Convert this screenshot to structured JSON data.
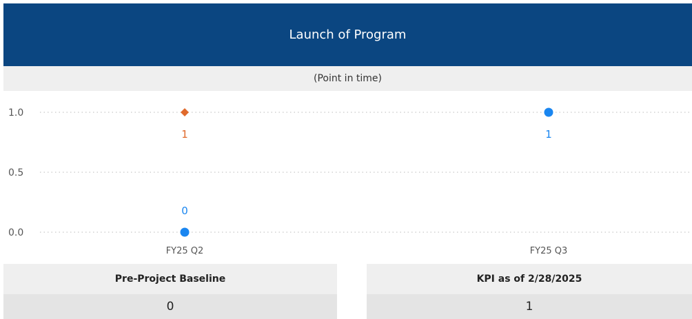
{
  "header": {
    "title": "Launch of Program",
    "subtitle": "(Point in time)"
  },
  "chart_data": {
    "type": "scatter",
    "categories": [
      "FY25 Q2",
      "FY25 Q3"
    ],
    "ylim": [
      0,
      1
    ],
    "yticks": [
      "1.0",
      "0.5",
      "0.0"
    ],
    "ytick_values": [
      1.0,
      0.5,
      0.0
    ],
    "grid": true,
    "series": [
      {
        "marker": "diamond",
        "color": "#e06a2c",
        "points": [
          {
            "category": "FY25 Q2",
            "value": 1,
            "label": "1"
          }
        ]
      },
      {
        "marker": "circle",
        "color": "#1a86f0",
        "points": [
          {
            "category": "FY25 Q2",
            "value": 0,
            "label": "0"
          },
          {
            "category": "FY25 Q3",
            "value": 1,
            "label": "1"
          }
        ]
      }
    ]
  },
  "cards": [
    {
      "label": "Pre-Project Baseline",
      "value": "0"
    },
    {
      "label": "KPI as of 2/28/2025",
      "value": "1"
    }
  ],
  "colors": {
    "header_bg": "#0b4681",
    "subheader_bg": "#efefef",
    "grid": "#c8c8c8"
  }
}
